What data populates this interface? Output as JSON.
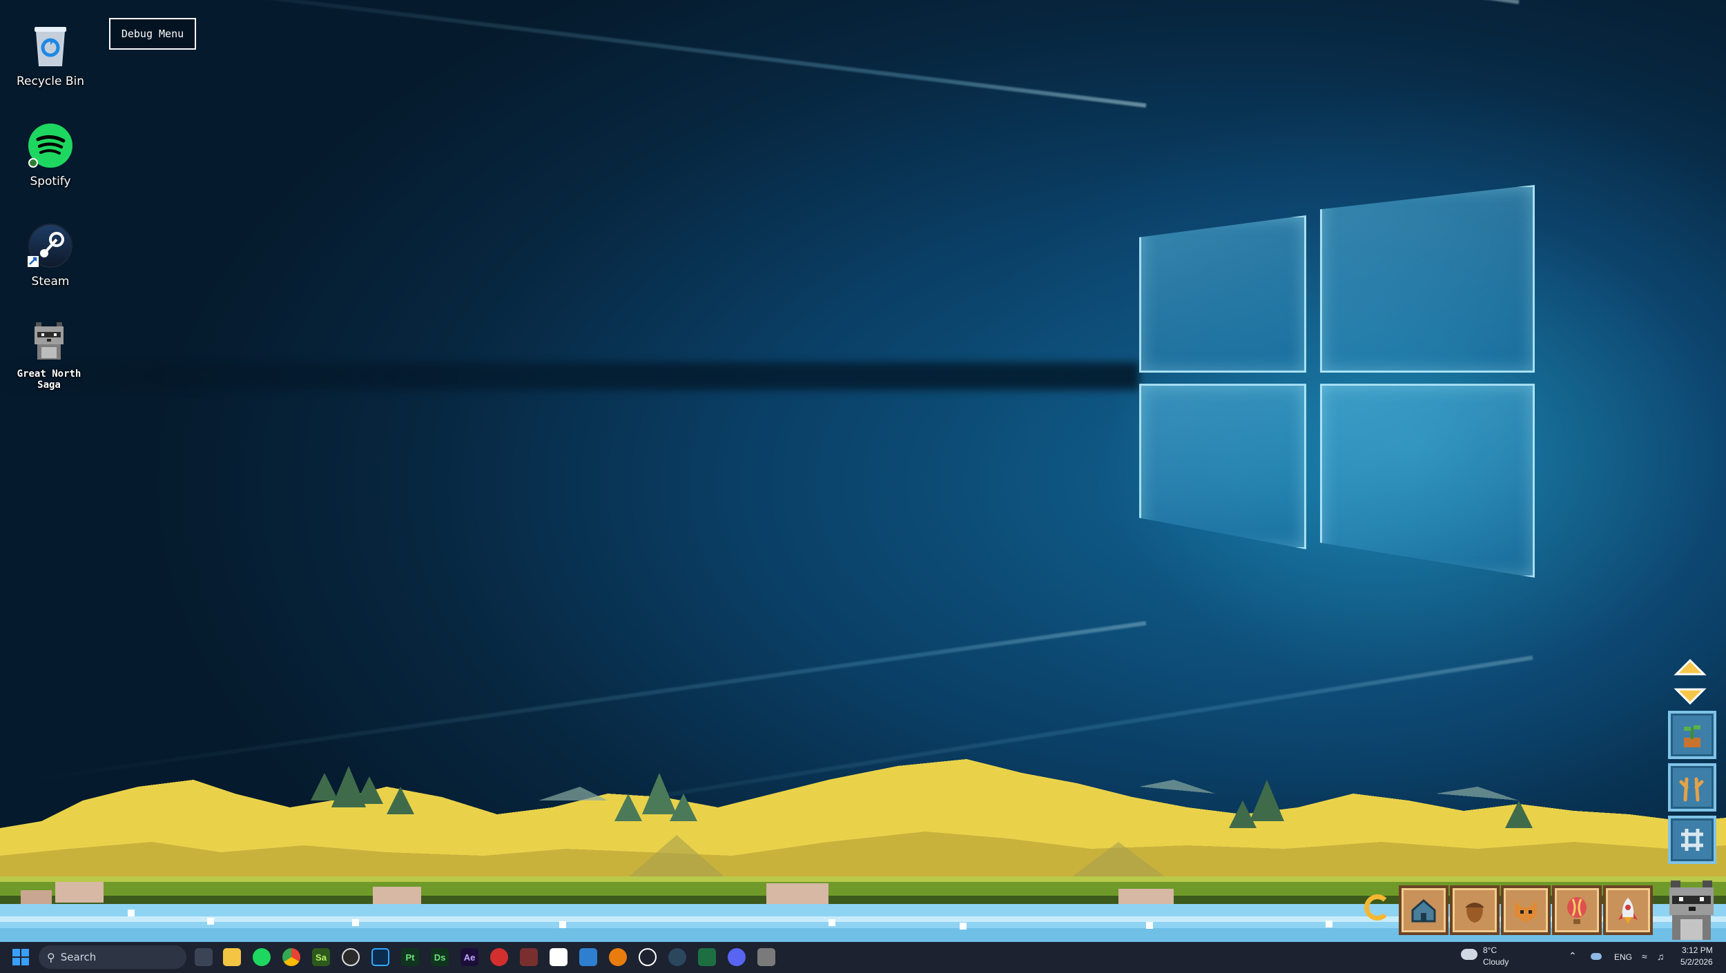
{
  "desktop": {
    "icons": [
      {
        "label": "Recycle Bin",
        "icon": "recycle-bin-icon"
      },
      {
        "label": "Spotify",
        "icon": "spotify-icon"
      },
      {
        "label": "Steam",
        "icon": "steam-icon"
      },
      {
        "label": "Great North Saga",
        "icon": "raccoon-icon"
      }
    ],
    "debug_menu_label": "Debug Menu"
  },
  "game": {
    "side_tools": [
      "scroll-arrows-icon",
      "plant-pot-icon",
      "antlers-icon",
      "grid-icon"
    ],
    "action_bar": [
      "home-icon",
      "acorn-icon",
      "fox-icon",
      "hot-air-balloon-icon",
      "rocket-icon"
    ],
    "colors": {
      "hills": "#e9d24a",
      "water": "#8fd3f2",
      "grass": "#6f9a2a",
      "button_wood": "#c9925a"
    }
  },
  "taskbar": {
    "search_placeholder": "Search",
    "apps": [
      "task-view-icon",
      "file-explorer-icon",
      "spotify-icon",
      "chrome-icon",
      "substance-icon",
      "obs-icon",
      "photoshop-icon",
      "painter-icon",
      "designer-icon",
      "after-effects-icon",
      "vpn-icon",
      "app-icon",
      "rider-icon",
      "vs-code-icon",
      "blender-icon",
      "github-icon",
      "steam-icon",
      "excel-icon",
      "discord-icon",
      "raccoon-icon"
    ],
    "app_labels": {
      "sa": "Sa",
      "pt": "Pt",
      "ds": "Ds",
      "ae": "Ae"
    },
    "weather": {
      "temp": "8°C",
      "condition": "Cloudy"
    },
    "language": "ENG",
    "time": "3:12 PM",
    "date": "5/2/2026"
  }
}
